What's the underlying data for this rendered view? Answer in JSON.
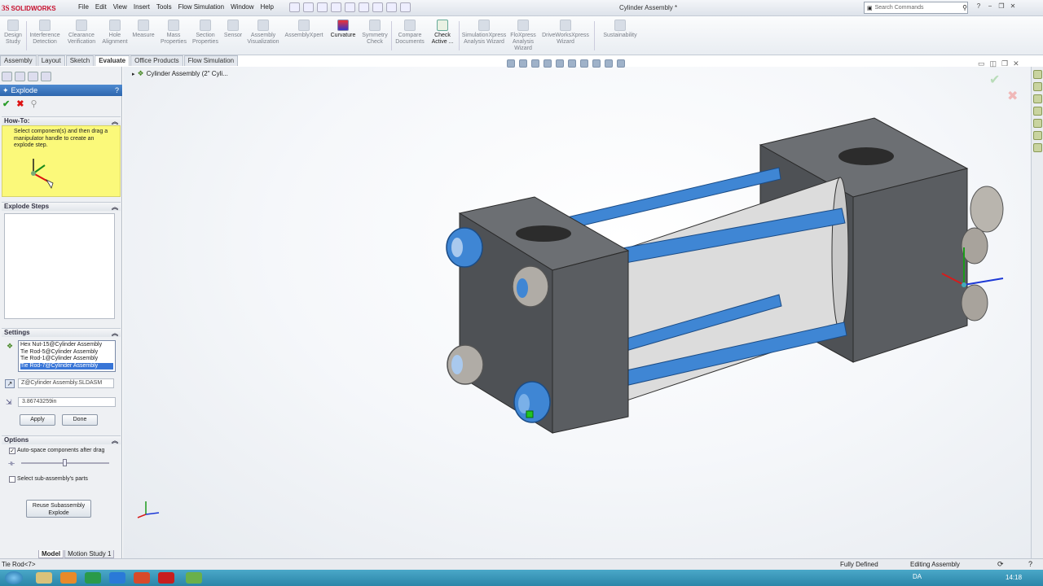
{
  "app": {
    "logo_text": "SOLIDWORKS",
    "window_title": "Cylinder Assembly *"
  },
  "menu": [
    "File",
    "Edit",
    "View",
    "Insert",
    "Tools",
    "Flow Simulation",
    "Window",
    "Help"
  ],
  "search": {
    "placeholder": "Search Commands"
  },
  "ribbon": [
    {
      "label": "Design Study"
    },
    {
      "label": "Interference Detection"
    },
    {
      "label": "Clearance Verification"
    },
    {
      "label": "Hole Alignment"
    },
    {
      "label": "Measure"
    },
    {
      "label": "Mass Properties"
    },
    {
      "label": "Section Properties"
    },
    {
      "label": "Sensor"
    },
    {
      "label": "Assembly Visualization"
    },
    {
      "label": "AssemblyXpert"
    },
    {
      "label": "Curvature"
    },
    {
      "label": "Symmetry Check"
    },
    {
      "label": "Compare Documents"
    },
    {
      "label": "Check Active ..."
    },
    {
      "label": "SimulationXpress Analysis Wizard"
    },
    {
      "label": "FloXpress Analysis Wizard"
    },
    {
      "label": "DriveWorksXpress Wizard"
    },
    {
      "label": "Sustainability"
    }
  ],
  "cm_tabs": [
    "Assembly",
    "Layout",
    "Sketch",
    "Evaluate",
    "Office Products",
    "Flow Simulation"
  ],
  "cm_active": "Evaluate",
  "property_manager": {
    "title": "Explode",
    "howto_header": "How-To:",
    "howto_text": "Select component(s) and then drag a manipulator handle to create an explode step.",
    "steps_header": "Explode Steps",
    "settings_header": "Settings",
    "components": [
      "Hex Nut-15@Cylinder Assembly",
      "Tie Rod-5@Cylinder Assembly",
      "Tie Rod-1@Cylinder Assembly",
      "Tie Rod-7@Cylinder Assembly"
    ],
    "direction_value": "Z@Cylinder Assembly.SLDASM",
    "distance_value": "3.86743259in",
    "apply_label": "Apply",
    "done_label": "Done",
    "options_header": "Options",
    "auto_space_label": "Auto-space components after drag",
    "auto_space_checked": true,
    "sub_assembly_label": "Select sub-assembly's parts",
    "sub_assembly_checked": false,
    "reuse_label": "Reuse Subassembly Explode"
  },
  "bottom_tabs": [
    "Model",
    "Motion Study 1"
  ],
  "breadcrumb": "Cylinder Assembly  (2\" Cyli...",
  "status": {
    "left": "Tie Rod<7>",
    "defined": "Fully Defined",
    "mode": "Editing Assembly"
  },
  "taskbar": {
    "lang": "DA",
    "time": "14:18"
  }
}
